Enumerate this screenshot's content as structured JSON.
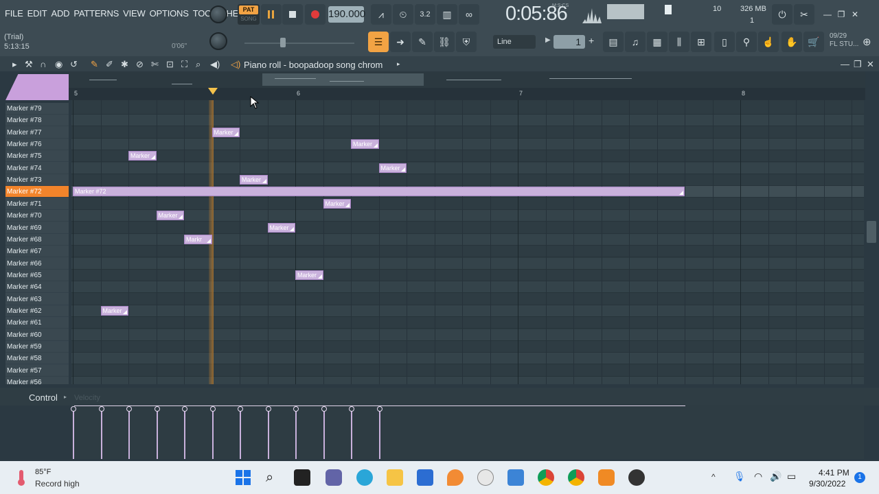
{
  "menu": [
    "FILE",
    "EDIT",
    "ADD",
    "PATTERNS",
    "VIEW",
    "OPTIONS",
    "TOOLS",
    "HELP"
  ],
  "hint": {
    "mode": "(Trial)",
    "position": "5:13:15",
    "time": "0'06\""
  },
  "transport": {
    "pat_label": "PAT",
    "song_label": "SONG",
    "tempo": "190.000",
    "time": "0:05:86",
    "time_unit": "M:S:CS"
  },
  "monitor": {
    "cpu": "10",
    "memory": "326 MB",
    "polyphony": "1"
  },
  "snap": {
    "value": "Line"
  },
  "pattern_number": "1",
  "news": {
    "date": "09/29",
    "text": "FL STU..."
  },
  "piano_roll": {
    "title": "Piano roll - boopadoop song chrom",
    "bars": [
      "5",
      "6",
      "7",
      "8"
    ],
    "selected_key": "Marker #72",
    "keys": [
      "Marker #79",
      "Marker #78",
      "Marker #77",
      "Marker #76",
      "Marker #75",
      "Marker #74",
      "Marker #73",
      "Marker #72",
      "Marker #71",
      "Marker #70",
      "Marker #69",
      "Marker #68",
      "Marker #67",
      "Marker #66",
      "Marker #65",
      "Marker #64",
      "Marker #63",
      "Marker #62",
      "Marker #61",
      "Marker #60",
      "Marker #59",
      "Marker #58",
      "Marker #57",
      "Marker #56"
    ],
    "notes": [
      {
        "label": "Marker",
        "key": "Marker #77"
      },
      {
        "label": "Marker",
        "key": "Marker #76"
      },
      {
        "label": "Marker",
        "key": "Marker #75"
      },
      {
        "label": "Marker",
        "key": "Marker #74"
      },
      {
        "label": "Marker",
        "key": "Marker #73"
      },
      {
        "label": "Marker #72",
        "key": "Marker #72"
      },
      {
        "label": "Marker",
        "key": "Marker #71"
      },
      {
        "label": "Marker",
        "key": "Marker #70"
      },
      {
        "label": "Marker",
        "key": "Marker #69"
      },
      {
        "label": "Markr",
        "key": "Marker #68"
      },
      {
        "label": "Marker",
        "key": "Marker #65"
      },
      {
        "label": "Marker",
        "key": "Marker #62"
      }
    ]
  },
  "control": {
    "label": "Control",
    "lane": "Velocity"
  },
  "taskbar": {
    "weather_temp": "85°F",
    "weather_text": "Record high",
    "clock_time": "4:41 PM",
    "clock_date": "9/30/2022",
    "notifications": "1"
  },
  "colors": {
    "accent": "#f2842b",
    "note": "#c9b1dc",
    "background": "#2b3942"
  }
}
